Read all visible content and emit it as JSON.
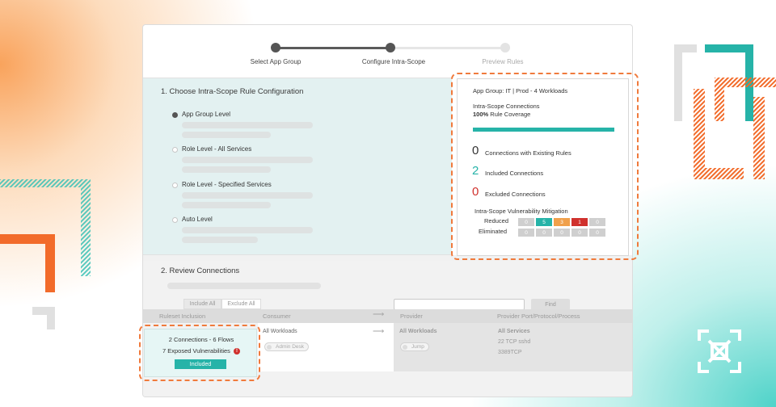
{
  "colors": {
    "brand_orange": "#f26b2a",
    "brand_teal": "#26b3a8",
    "alert_red": "#d0312d",
    "warning_orange": "#f0a04b",
    "neutral_gray": "#cfcfcf"
  },
  "stepper": {
    "steps": [
      {
        "label": "Select App Group",
        "state": "done"
      },
      {
        "label": "Configure Intra-Scope",
        "state": "current"
      },
      {
        "label": "Preview Rules",
        "state": "todo"
      }
    ]
  },
  "rule_config": {
    "title": "1. Choose Intra-Scope Rule Configuration",
    "options": [
      {
        "label": "App Group Level",
        "checked": true
      },
      {
        "label": "Role Level - All Services",
        "checked": false
      },
      {
        "label": "Role Level - Specified Services",
        "checked": false
      },
      {
        "label": "Auto Level",
        "checked": false
      }
    ]
  },
  "summary": {
    "app_group_label": "App Group:",
    "app_group_value": "IT | Prod - 4 Workloads",
    "connections_title": "Intra-Scope Connections",
    "coverage_value": "100%",
    "coverage_label": "Rule Coverage",
    "coverage_fraction": 1.0,
    "existing_count": "0",
    "existing_label": "Connections with Existing Rules",
    "included_count": "2",
    "included_label": "Included Connections",
    "excluded_count": "0",
    "excluded_label": "Excluded Connections",
    "mitigation_title": "Intra-Scope Vulnerability Mitigation",
    "reduced_label": "Reduced",
    "reduced_values": [
      "0",
      "5",
      "3",
      "1",
      "0"
    ],
    "eliminated_label": "Eliminated",
    "eliminated_values": [
      "0",
      "0",
      "0",
      "0",
      "0"
    ]
  },
  "review": {
    "title": "2. Review Connections",
    "include_all": "Include All",
    "exclude_all": "Exclude All",
    "find": "Find",
    "columns": [
      "Ruleset Inclusion",
      "Consumer",
      "Provider",
      "Provider Port/Protocol/Process"
    ],
    "row": {
      "connections": "2 Connections - 6 Flows",
      "vulnerabilities": "7 Exposed Vulnerabilities",
      "alert_glyph": "!",
      "status": "Included",
      "consumer": "All Workloads",
      "consumer_label": "Admin Desk",
      "provider": "All Workloads",
      "provider_label": "Jump",
      "services_title": "All Services",
      "service_1": "22 TCP sshd",
      "service_2": "3389TCP"
    }
  }
}
